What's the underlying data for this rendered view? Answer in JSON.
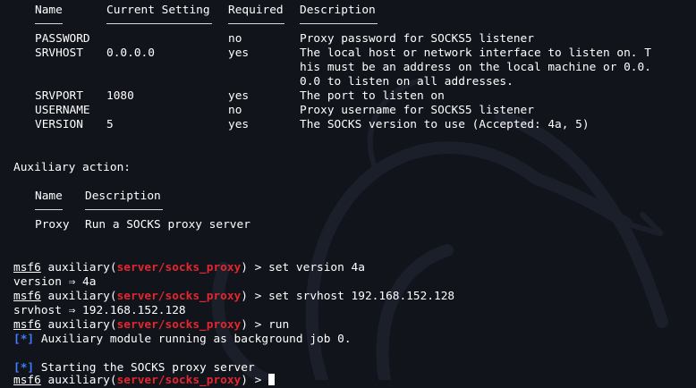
{
  "options_table": {
    "headers": [
      "Name",
      "Current Setting",
      "Required",
      "Description"
    ],
    "rows": [
      {
        "name": "PASSWORD",
        "setting": "",
        "required": "no",
        "desc": [
          "Proxy password for SOCKS5 listener"
        ]
      },
      {
        "name": "SRVHOST",
        "setting": "0.0.0.0",
        "required": "yes",
        "desc": [
          "The local host or network interface to listen on. T",
          "his must be an address on the local machine or 0.0.",
          "0.0 to listen on all addresses."
        ]
      },
      {
        "name": "SRVPORT",
        "setting": "1080",
        "required": "yes",
        "desc": [
          "The port to listen on"
        ]
      },
      {
        "name": "USERNAME",
        "setting": "",
        "required": "no",
        "desc": [
          "Proxy username for SOCKS5 listener"
        ]
      },
      {
        "name": "VERSION",
        "setting": "5",
        "required": "yes",
        "desc": [
          "The SOCKS version to use (Accepted: 4a, 5)"
        ]
      }
    ]
  },
  "aux_action": {
    "title": "Auxiliary action:",
    "headers": [
      "Name",
      "Description"
    ],
    "row": {
      "name": "Proxy",
      "desc": "Run a SOCKS proxy server"
    }
  },
  "prompt": {
    "prefix": "msf6",
    "mid": " auxiliary(",
    "module": "server/socks_proxy",
    "suffix": ") > "
  },
  "commands": [
    {
      "cmd": "set version 4a",
      "output": "version ⇒ 4a"
    },
    {
      "cmd": "set srvhost 192.168.152.128",
      "output": "srvhost ⇒ 192.168.152.128"
    },
    {
      "cmd": "run",
      "output": ""
    }
  ],
  "status": {
    "marker": "[*]",
    "line1": " Auxiliary module running as background job 0.",
    "line2": " Starting the SOCKS proxy server"
  },
  "colors": {
    "background": "#12141c",
    "prompt_module": "#e3262f",
    "status_marker": "#3f7cff"
  }
}
